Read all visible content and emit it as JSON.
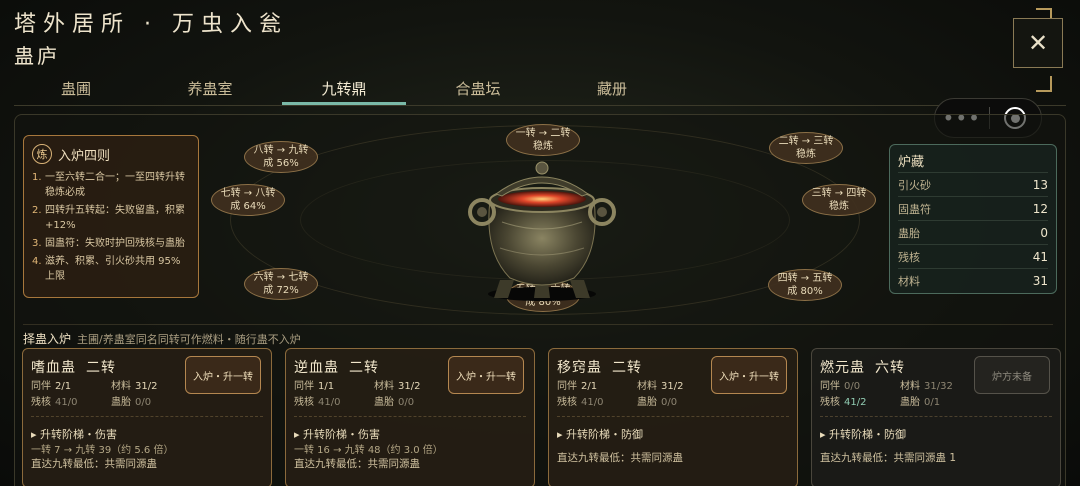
{
  "header": {
    "title": "塔外居所 · 万虫入瓮",
    "subtitle": "蛊庐",
    "close_icon": "close-icon"
  },
  "tabs": [
    {
      "label": "蛊圃",
      "active": false
    },
    {
      "label": "养蛊室",
      "active": false
    },
    {
      "label": "九转鼎",
      "active": true
    },
    {
      "label": "合蛊坛",
      "active": false
    },
    {
      "label": "藏册",
      "active": false
    }
  ],
  "toolbar": {
    "more_label": "•••"
  },
  "rules": {
    "badge": "炼",
    "title": "入炉四则",
    "items": [
      {
        "n": "1.",
        "text": "一至六转二合一；一至四转升转稳炼必成"
      },
      {
        "n": "2.",
        "text": "四转升五转起：失败留蛊，积累 +12%"
      },
      {
        "n": "3.",
        "text": "固蛊符：失败时护回残核与蛊胎"
      },
      {
        "n": "4.",
        "text": "滋养、积累、引火砂共用 95% 上限"
      }
    ]
  },
  "nodes": [
    {
      "from": "一转",
      "to": "二转",
      "sub": "稳炼"
    },
    {
      "from": "二转",
      "to": "三转",
      "sub": "稳炼"
    },
    {
      "from": "三转",
      "to": "四转",
      "sub": "稳炼"
    },
    {
      "from": "四转",
      "to": "五转",
      "sub": "成 80%"
    },
    {
      "from": "五转",
      "to": "六转",
      "sub": "成 80%"
    },
    {
      "from": "六转",
      "to": "七转",
      "sub": "成 72%"
    },
    {
      "from": "七转",
      "to": "八转",
      "sub": "成 64%"
    },
    {
      "from": "八转",
      "to": "九转",
      "sub": "成 56%"
    }
  ],
  "storage": {
    "title": "炉藏",
    "rows": [
      {
        "label": "引火砂",
        "value": "13"
      },
      {
        "label": "固蛊符",
        "value": "12"
      },
      {
        "label": "蛊胎",
        "value": "0"
      },
      {
        "label": "残核",
        "value": "41"
      },
      {
        "label": "材料",
        "value": "31"
      }
    ]
  },
  "select": {
    "title": "择蛊入炉",
    "subtitle": "主圃/养蛊室同名同转可作燃料・随行蛊不入炉"
  },
  "cards": [
    {
      "name": "嗜血蛊",
      "rank": "二转",
      "button": "入炉・升一转",
      "stats": [
        {
          "label": "同伴",
          "value": "2/1",
          "style": "normal"
        },
        {
          "label": "材料",
          "value": "31/2",
          "style": "normal"
        },
        {
          "label": "残核",
          "value": "41/0",
          "style": "muted"
        },
        {
          "label": "蛊胎",
          "value": "0/0",
          "style": "muted"
        }
      ],
      "path_title": "▸ 升转阶梯・伤害",
      "path_line1": "一转 7 → 九转 39（约 5.6 倍）",
      "path_line2": "直达九转最低：共需同源蛊",
      "path_line3": ""
    },
    {
      "name": "逆血蛊",
      "rank": "二转",
      "button": "入炉・升一转",
      "stats": [
        {
          "label": "同伴",
          "value": "1/1",
          "style": "normal"
        },
        {
          "label": "材料",
          "value": "31/2",
          "style": "normal"
        },
        {
          "label": "残核",
          "value": "41/0",
          "style": "muted"
        },
        {
          "label": "蛊胎",
          "value": "0/0",
          "style": "muted"
        }
      ],
      "path_title": "▸ 升转阶梯・伤害",
      "path_line1": "一转 16 → 九转 48（约 3.0 倍）",
      "path_line2": "直达九转最低：共需同源蛊",
      "path_line3": ""
    },
    {
      "name": "移窍蛊",
      "rank": "二转",
      "button": "入炉・升一转",
      "stats": [
        {
          "label": "同伴",
          "value": "2/1",
          "style": "normal"
        },
        {
          "label": "材料",
          "value": "31/2",
          "style": "normal"
        },
        {
          "label": "残核",
          "value": "41/0",
          "style": "muted"
        },
        {
          "label": "蛊胎",
          "value": "0/0",
          "style": "muted"
        }
      ],
      "path_title": "▸ 升转阶梯・防御",
      "path_line1": "",
      "path_line2": "直达九转最低：共需同源蛊",
      "path_line3": ""
    },
    {
      "name": "燃元蛊",
      "rank": "六转",
      "button": "炉方未备",
      "stats": [
        {
          "label": "同伴",
          "value": "0/0",
          "style": "muted"
        },
        {
          "label": "材料",
          "value": "31/32",
          "style": "muted"
        },
        {
          "label": "残核",
          "value": "41/2",
          "style": "green"
        },
        {
          "label": "蛊胎",
          "value": "0/1",
          "style": "muted"
        }
      ],
      "path_title": "▸ 升转阶梯・防御",
      "path_line1": "",
      "path_line2": "直达九转最低：共需同源蛊 1",
      "path_line3": ""
    }
  ]
}
